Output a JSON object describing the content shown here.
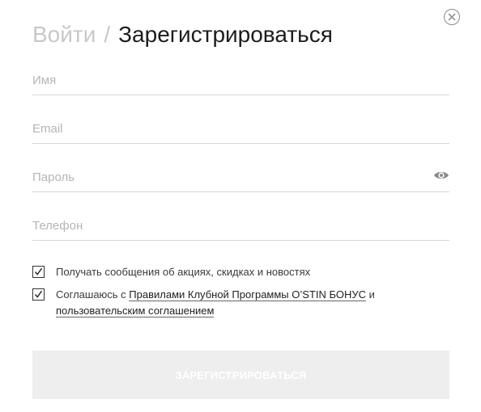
{
  "header": {
    "login_tab": "Войти",
    "separator": "/",
    "register_tab": "Зарегистрироваться"
  },
  "form": {
    "name_placeholder": "Имя",
    "email_placeholder": "Email",
    "password_placeholder": "Пароль",
    "phone_placeholder": "Телефон"
  },
  "consents": {
    "news": {
      "checked": true,
      "text": "Получать сообщения об акциях, скидках и новостях"
    },
    "agreement": {
      "checked": true,
      "prefix": "Соглашаюсь с ",
      "rules_link": "Правилами Клубной Программы O’STIN БОНУС",
      "middle": " и",
      "user_agreement_link": "пользовательским соглашением"
    }
  },
  "submit_label": "ЗАРЕГИСТРИРОВАТЬСЯ",
  "icons": {
    "close": "close-icon",
    "password_toggle": "eye-icon",
    "check": "check-icon"
  },
  "colors": {
    "inactive_tab": "#c8c8c8",
    "active_tab": "#1d1d1d",
    "disabled_button_bg": "#eeeeee"
  }
}
